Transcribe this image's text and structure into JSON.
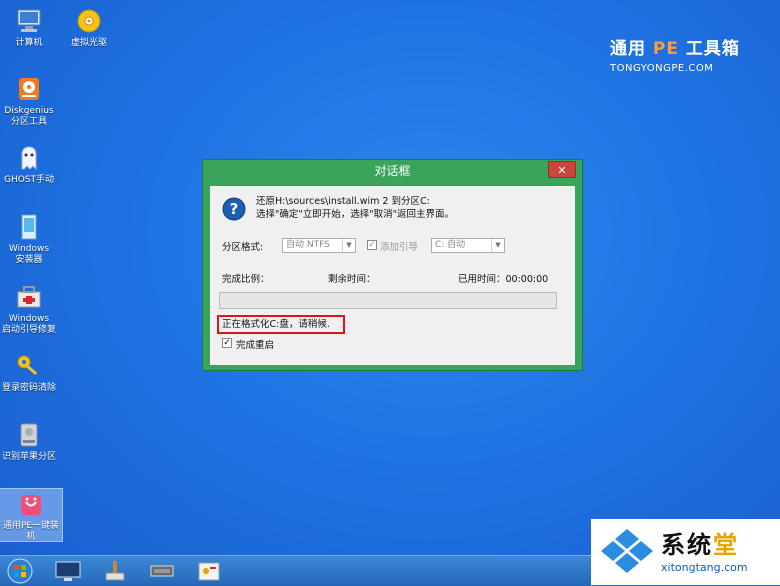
{
  "desktop": {
    "icons": [
      {
        "label": "计算机"
      },
      {
        "label": "虚拟光驱"
      },
      {
        "label": "Diskgenius\n分区工具"
      },
      {
        "label": "GHOST手动"
      },
      {
        "label": "Windows\n安装器"
      },
      {
        "label": "Windows\n启动引导修复"
      },
      {
        "label": "登录密码清除"
      },
      {
        "label": "识别苹果分区"
      },
      {
        "label": "通用PE一键装\n机"
      }
    ]
  },
  "brand": {
    "prefix": "通用",
    "pe": "PE",
    "suffix": "工具箱",
    "url": "TONGYONGPE.COM"
  },
  "dialog": {
    "title": "对话框",
    "close": "✕",
    "message_line1": "还原H:\\sources\\install.wim 2 到分区C:",
    "message_line2": "选择\"确定\"立即开始，选择\"取消\"返回主界面。",
    "partition_format_label": "分区格式:",
    "format_value": "自动 NTFS",
    "add_boot_label": "添加引导",
    "boot_value": "C: 自动",
    "progress_label": "完成比例：",
    "remaining_label": "剩余时间：",
    "elapsed_label": "已用时间：00:00:00",
    "progress": 0,
    "status_text": "正在格式化C:盘，请稍候.",
    "restart_label": "完成重启",
    "restart_checked": "✓",
    "boot_checked": "✓"
  },
  "watermark": {
    "text_a": "系统",
    "text_b": "堂",
    "url": "xitongtang.com"
  },
  "taskbar": {
    "items": [
      "start-orb-icon",
      "monitor-icon",
      "brush-icon",
      "chip-icon",
      "tools-icon"
    ]
  }
}
